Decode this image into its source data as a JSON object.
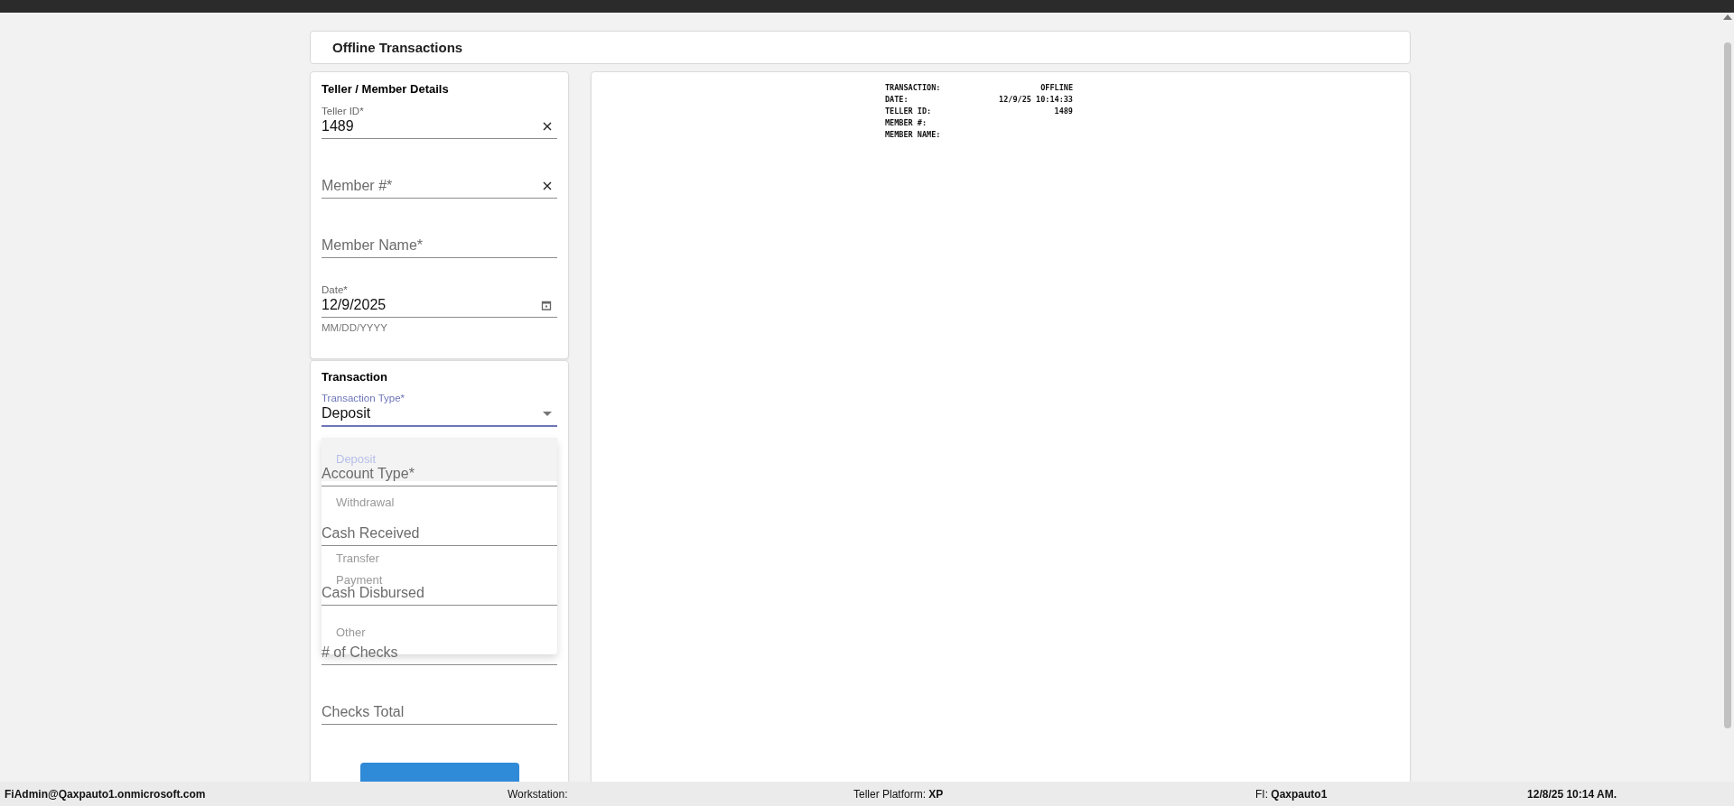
{
  "header": {
    "title": "Offline Transactions"
  },
  "details": {
    "title": "Teller / Member Details",
    "fields": [
      {
        "kind": "clearable",
        "label": "Teller ID*",
        "value": "1489"
      },
      {
        "kind": "clearable",
        "label": "Member #*"
      },
      {
        "kind": "text",
        "label": "Member Name*"
      },
      {
        "kind": "date",
        "label": "Date*",
        "value": "12/9/2025",
        "helper": "MM/DD/YYYY"
      }
    ]
  },
  "transaction": {
    "title": "Transaction",
    "select": {
      "label": "Transaction Type*",
      "value": "Deposit",
      "expanded": true,
      "options": [
        {
          "label": "Deposit",
          "selected": true
        },
        {
          "label": "Withdrawal",
          "selected": false
        },
        {
          "label": "Transfer",
          "selected": false
        },
        {
          "label": "Payment",
          "selected": false
        },
        {
          "label": "Other",
          "selected": false
        }
      ]
    },
    "fields": [
      {
        "kind": "text",
        "label": "Account Type*"
      },
      {
        "kind": "text",
        "label": "Cash Received"
      },
      {
        "kind": "text",
        "label": "Cash Disbursed"
      },
      {
        "kind": "text",
        "label": "# of Checks"
      },
      {
        "kind": "text",
        "label": "Checks Total"
      }
    ]
  },
  "receipt": {
    "lines": [
      {
        "label": "TRANSACTION:",
        "value": "OFFLINE"
      },
      {
        "label": "DATE:",
        "value": "12/9/25 10:14:33"
      },
      {
        "label": "TELLER ID:",
        "value": "1489"
      },
      {
        "label": "MEMBER #:"
      },
      {
        "label": "MEMBER NAME:"
      }
    ]
  },
  "status_bar": {
    "user": "FiAdmin@Qaxpauto1.onmicrosoft.com",
    "workstation": "Workstation:",
    "platform_label": "Teller Platform:",
    "platform": "XP",
    "fi_label": "FI:",
    "fi": "Qaxpauto1",
    "time": "12/8/25 10:14 AM."
  }
}
